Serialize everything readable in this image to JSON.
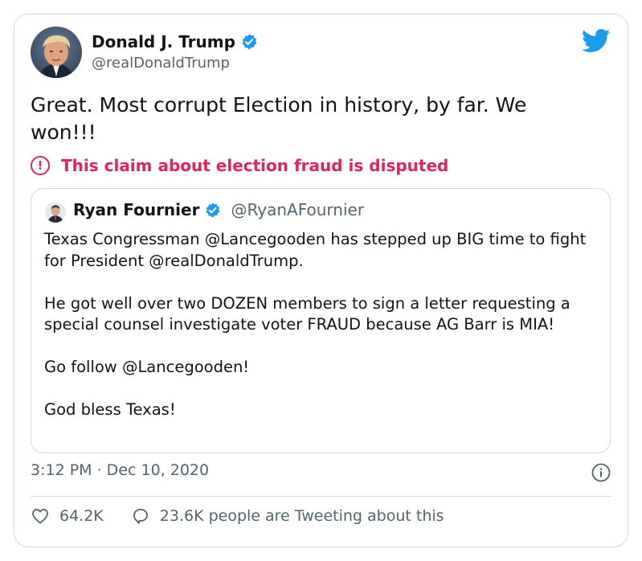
{
  "author": {
    "name": "Donald J. Trump",
    "handle": "@realDonaldTrump",
    "avatar_icon": "profile-photo",
    "verified": true
  },
  "tweet": {
    "text_line1": "Great. Most corrupt Election in history, by far. We",
    "text_line2": "won!!!"
  },
  "disputed_notice": {
    "icon": "exclamation-circle-icon",
    "text": "This claim about election fraud is disputed"
  },
  "quoted_tweet": {
    "name": "Ryan Fournier",
    "handle": "@RyanAFournier",
    "verified": true,
    "paragraphs": [
      "Texas Congressman @Lancegooden has stepped up BIG time to fight for President @realDonaldTrump.",
      "He got well over two DOZEN members to sign a letter requesting a special counsel investigate voter FRAUD because AG Barr is MIA!",
      "Go follow @Lancegooden!",
      "God bless Texas!"
    ]
  },
  "timestamp": "3:12 PM · Dec 10, 2020",
  "actions": {
    "likes": "64.2K",
    "conversation": "23.6K people are Tweeting about this"
  },
  "colors": {
    "disputed": "#e0245e",
    "twitter_blue": "#1d9bf0",
    "muted_text": "#536471",
    "border": "#cfd9de"
  }
}
